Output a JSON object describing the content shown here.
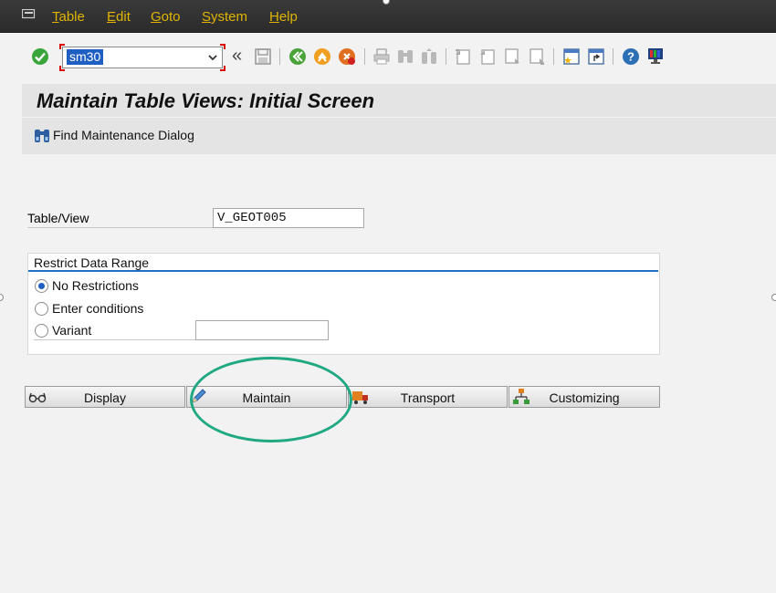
{
  "menu": {
    "items": [
      {
        "label": "Table",
        "accel": "T",
        "rest": "able"
      },
      {
        "label": "Edit",
        "accel": "E",
        "rest": "dit"
      },
      {
        "label": "Goto",
        "accel": "G",
        "rest": "oto"
      },
      {
        "label": "System",
        "accel": "S",
        "rest": "ystem"
      },
      {
        "label": "Help",
        "accel": "H",
        "rest": "elp"
      }
    ]
  },
  "toolbar": {
    "command_value": "sm30",
    "expand_glyph": "«",
    "icons": [
      "enter-icon",
      "save-icon",
      "back-icon",
      "exit-icon",
      "cancel-icon",
      "print-icon",
      "find-icon",
      "find-next-icon",
      "first-page-icon",
      "previous-page-icon",
      "next-page-icon",
      "last-page-icon",
      "create-session-icon",
      "shortcut-icon",
      "help-icon",
      "customize-layout-icon"
    ]
  },
  "title": "Maintain Table Views: Initial Screen",
  "app_toolbar": {
    "find_label": "Find Maintenance Dialog"
  },
  "table_view": {
    "label": "Table/View",
    "value": "V_GEOT005"
  },
  "restrict": {
    "title": "Restrict Data Range",
    "options": [
      {
        "label": "No Restrictions",
        "selected": true
      },
      {
        "label": "Enter conditions",
        "selected": false
      },
      {
        "label": "Variant",
        "selected": false
      }
    ],
    "variant_value": ""
  },
  "actions": [
    {
      "label": "Display",
      "icon": "glasses-icon"
    },
    {
      "label": "Maintain",
      "icon": "pencil-icon"
    },
    {
      "label": "Transport",
      "icon": "truck-icon"
    },
    {
      "label": "Customizing",
      "icon": "hierarchy-icon"
    }
  ],
  "colors": {
    "menu_text": "#e0b400",
    "highlight_ring": "#1fa882",
    "selection_blue": "#1f5fc4"
  }
}
